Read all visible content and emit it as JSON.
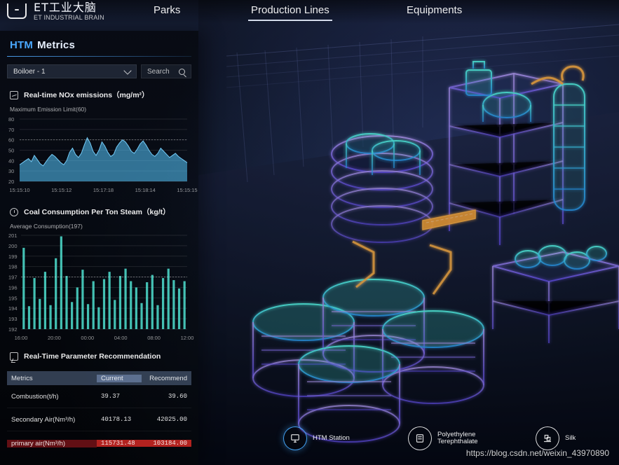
{
  "brand": {
    "logo_cn": "ET工业大脑",
    "logo_en": "ET INDUSTRIAL BRAIN"
  },
  "top_nav": {
    "items": [
      {
        "label": "Parks",
        "active": false
      },
      {
        "label": "Production Lines",
        "active": true
      },
      {
        "label": "Equipments",
        "active": false
      }
    ]
  },
  "left_panel": {
    "title": {
      "accent": "HTM",
      "rest": "Metrics"
    },
    "selector": {
      "value": "Boiloer - 1"
    },
    "search": {
      "placeholder": "Search"
    },
    "nox_section": {
      "title": "Real-time NOx emissions（mg/m²）",
      "subhead": "Maximum Emission Limit(60)"
    },
    "coal_section": {
      "title": "Coal Consumption Per Ton Steam（kg/t）",
      "subhead": "Average Consumption(197)"
    },
    "recommendation_section": {
      "title": "Real-Time Parameter Recommendation"
    }
  },
  "charts": {
    "nox": {
      "type": "area",
      "x": [
        "15:15:10",
        "15:15:12",
        "15:17:18",
        "15:18:14",
        "15:15:15"
      ],
      "y_ticks": [
        20,
        30,
        40,
        50,
        60,
        70,
        80
      ],
      "threshold": 60,
      "series": [
        {
          "values": [
            36,
            38,
            40,
            42,
            39,
            45,
            41,
            37,
            35,
            39,
            43,
            46,
            44,
            41,
            38,
            36,
            40,
            48,
            52,
            46,
            43,
            47,
            55,
            62,
            57,
            49,
            45,
            50,
            58,
            54,
            48,
            44,
            46,
            53,
            57,
            60,
            58,
            54,
            49,
            47,
            51,
            56,
            59,
            55,
            50,
            46,
            44,
            47,
            52,
            49,
            46,
            43,
            45,
            47,
            44,
            42,
            40,
            38
          ]
        }
      ],
      "ylim": [
        20,
        80
      ]
    },
    "coal": {
      "type": "bar",
      "x_ticks": [
        "16:00",
        "20:00",
        "00:00",
        "04:00",
        "08:00",
        "12:00"
      ],
      "y_ticks": [
        192,
        193,
        194,
        195,
        196,
        197,
        198,
        199,
        200,
        201
      ],
      "average": 197,
      "series": [
        {
          "values": [
            199.8,
            194.2,
            196.9,
            194.9,
            197.5,
            194.3,
            198.8,
            200.9,
            197.1,
            194.6,
            196.0,
            197.7,
            194.4,
            196.6,
            194.1,
            196.8,
            197.5,
            194.8,
            197.1,
            197.8,
            196.6,
            196.0,
            194.5,
            196.5,
            197.2,
            194.3,
            196.9,
            197.8,
            196.7,
            195.9,
            196.6
          ]
        }
      ],
      "ylim": [
        192,
        201
      ]
    }
  },
  "recommend_table": {
    "headers": [
      "Metrics",
      "Current",
      "Recommend"
    ],
    "rows": [
      {
        "metric": "Combustion(t/h)",
        "current": "39.37",
        "recommend": "39.60",
        "alert": false
      },
      {
        "metric": "Secondary Air(Nm³/h)",
        "current": "40178.13",
        "recommend": "42025.00",
        "alert": false
      },
      {
        "metric": "primary air(Nm³/h)",
        "current": "115731.48",
        "recommend": "103184.00",
        "alert": true
      }
    ]
  },
  "bottom_nav": {
    "items": [
      {
        "label_line1": "HTM Station",
        "label_line2": "",
        "active": true,
        "icon": "monitor-icon"
      },
      {
        "label_line1": "Polyethylene",
        "label_line2": "Terephthalate",
        "active": false,
        "icon": "pet-icon"
      },
      {
        "label_line1": "Silk",
        "label_line2": "",
        "active": false,
        "icon": "silk-icon"
      }
    ]
  },
  "watermark": {
    "text": "https://blog.csdn.net/weixin_43970890"
  },
  "colors": {
    "accent": "#4aa8ff",
    "chart_cyan": "#55c8ff",
    "chart_bar": "#4fe0d0",
    "alert_red": "#d22823"
  }
}
